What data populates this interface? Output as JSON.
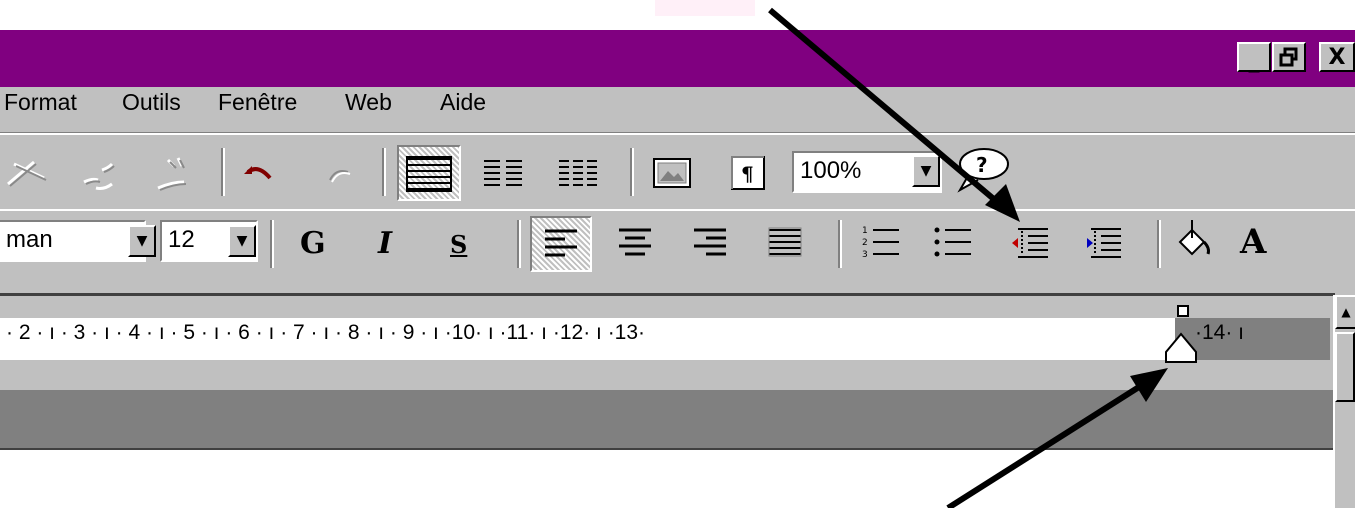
{
  "window": {
    "controls": [
      "_",
      "🗗",
      "X"
    ],
    "title_color": "#800080"
  },
  "menu": {
    "items": [
      "Format",
      "Outils",
      "Fenêtre",
      "Web",
      "Aide"
    ]
  },
  "toolbar_standard": {
    "zoom_value": "100%",
    "icons": [
      "cut-icon",
      "copy-icon",
      "paste-icon",
      "undo-icon",
      "redo-icon",
      "table-icon",
      "columns-2-icon",
      "columns-3-icon",
      "picture-icon",
      "pilcrow-icon",
      "help-assistant-icon"
    ]
  },
  "toolbar_format": {
    "font_name": "man",
    "font_size": "12",
    "bold_label": "G",
    "italic_label": "I",
    "underline_label": "S",
    "highlight_letter": "A"
  },
  "ruler": {
    "text_white": "· 2 · ı · 3 · ı · 4 · ı · 5 · ı · 6 · ı · 7 · ı · 8 · ı · 9 · ı ·10· ı ·11· ı ·12· ı ·13·",
    "text_gray": "·14· ı"
  },
  "scroll": {
    "up_arrow": "▲"
  }
}
